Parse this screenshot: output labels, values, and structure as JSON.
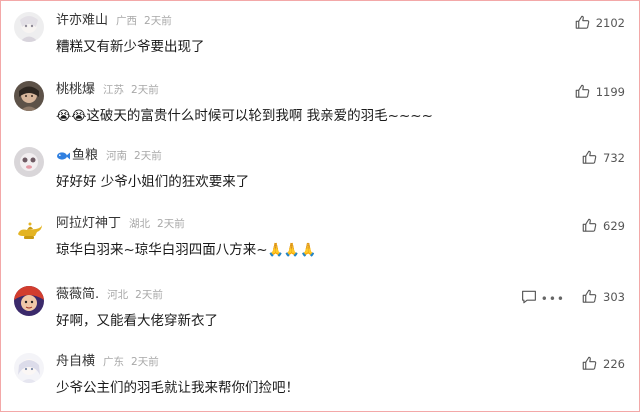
{
  "comments": [
    {
      "username": "许亦难山",
      "location": "广西",
      "time": "2天前",
      "text": "糟糕又有新少爷要出现了",
      "likes": "2102"
    },
    {
      "username": "桃桃爆",
      "location": "江苏",
      "time": "2天前",
      "text_prefix": "😭😭",
      "text": "这破天的富贵什么时候可以轮到我啊 我亲爱的羽毛~~~~",
      "likes": "1199"
    },
    {
      "username": "鱼粮",
      "location": "河南",
      "time": "2天前",
      "text": "好好好 少爷小姐们的狂欢要来了",
      "likes": "732"
    },
    {
      "username": "阿拉灯神丁",
      "location": "湖北",
      "time": "2天前",
      "text": "琼华白羽来~琼华白羽四面八方来~",
      "text_suffix": "🙏🙏🙏",
      "likes": "629"
    },
    {
      "username": "薇薇简.",
      "location": "河北",
      "time": "2天前",
      "text": "好啊，又能看大佬穿新衣了",
      "likes": "303"
    },
    {
      "username": "舟自横",
      "location": "广东",
      "time": "2天前",
      "text": "少爷公主们的羽毛就让我来帮你们捡吧！",
      "likes": "226"
    }
  ],
  "icons": {
    "like": "thumbs-up-icon",
    "reply": "comment-icon",
    "more": "more-icon",
    "badge": "fish-icon"
  },
  "colors": {
    "border": "#f3a8a8",
    "meta": "#a8a8a8"
  }
}
